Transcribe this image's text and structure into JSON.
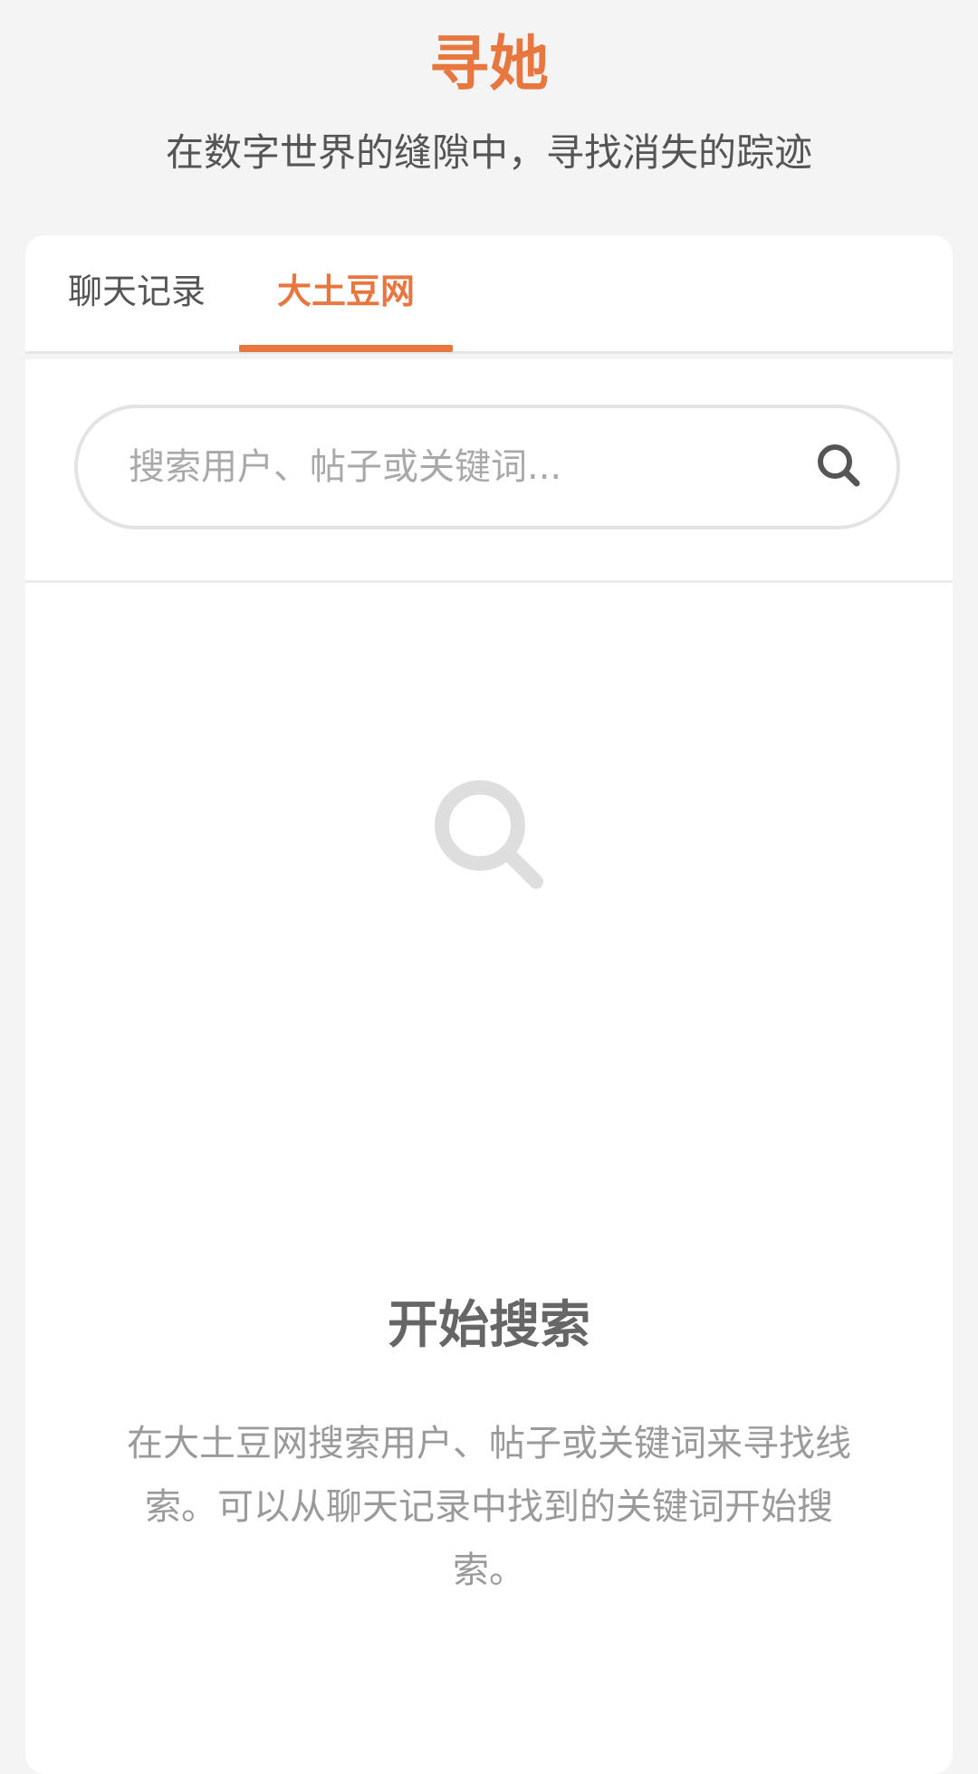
{
  "header": {
    "title": "寻她",
    "subtitle": "在数字世界的缝隙中，寻找消失的踪迹"
  },
  "tabs": [
    {
      "label": "聊天记录",
      "active": false
    },
    {
      "label": "大土豆网",
      "active": true
    }
  ],
  "search": {
    "placeholder": "搜索用户、帖子或关键词...",
    "value": "",
    "icon": "search-icon"
  },
  "empty_state": {
    "icon": "search-icon",
    "title": "开始搜索",
    "description": "在大土豆网搜索用户、帖子或关键词来寻找线索。可以从聊天记录中找到的关键词开始搜索。"
  },
  "colors": {
    "accent": "#e8773f",
    "background": "#f4f4f4",
    "card": "#ffffff",
    "muted_text": "#9a9a9a"
  }
}
